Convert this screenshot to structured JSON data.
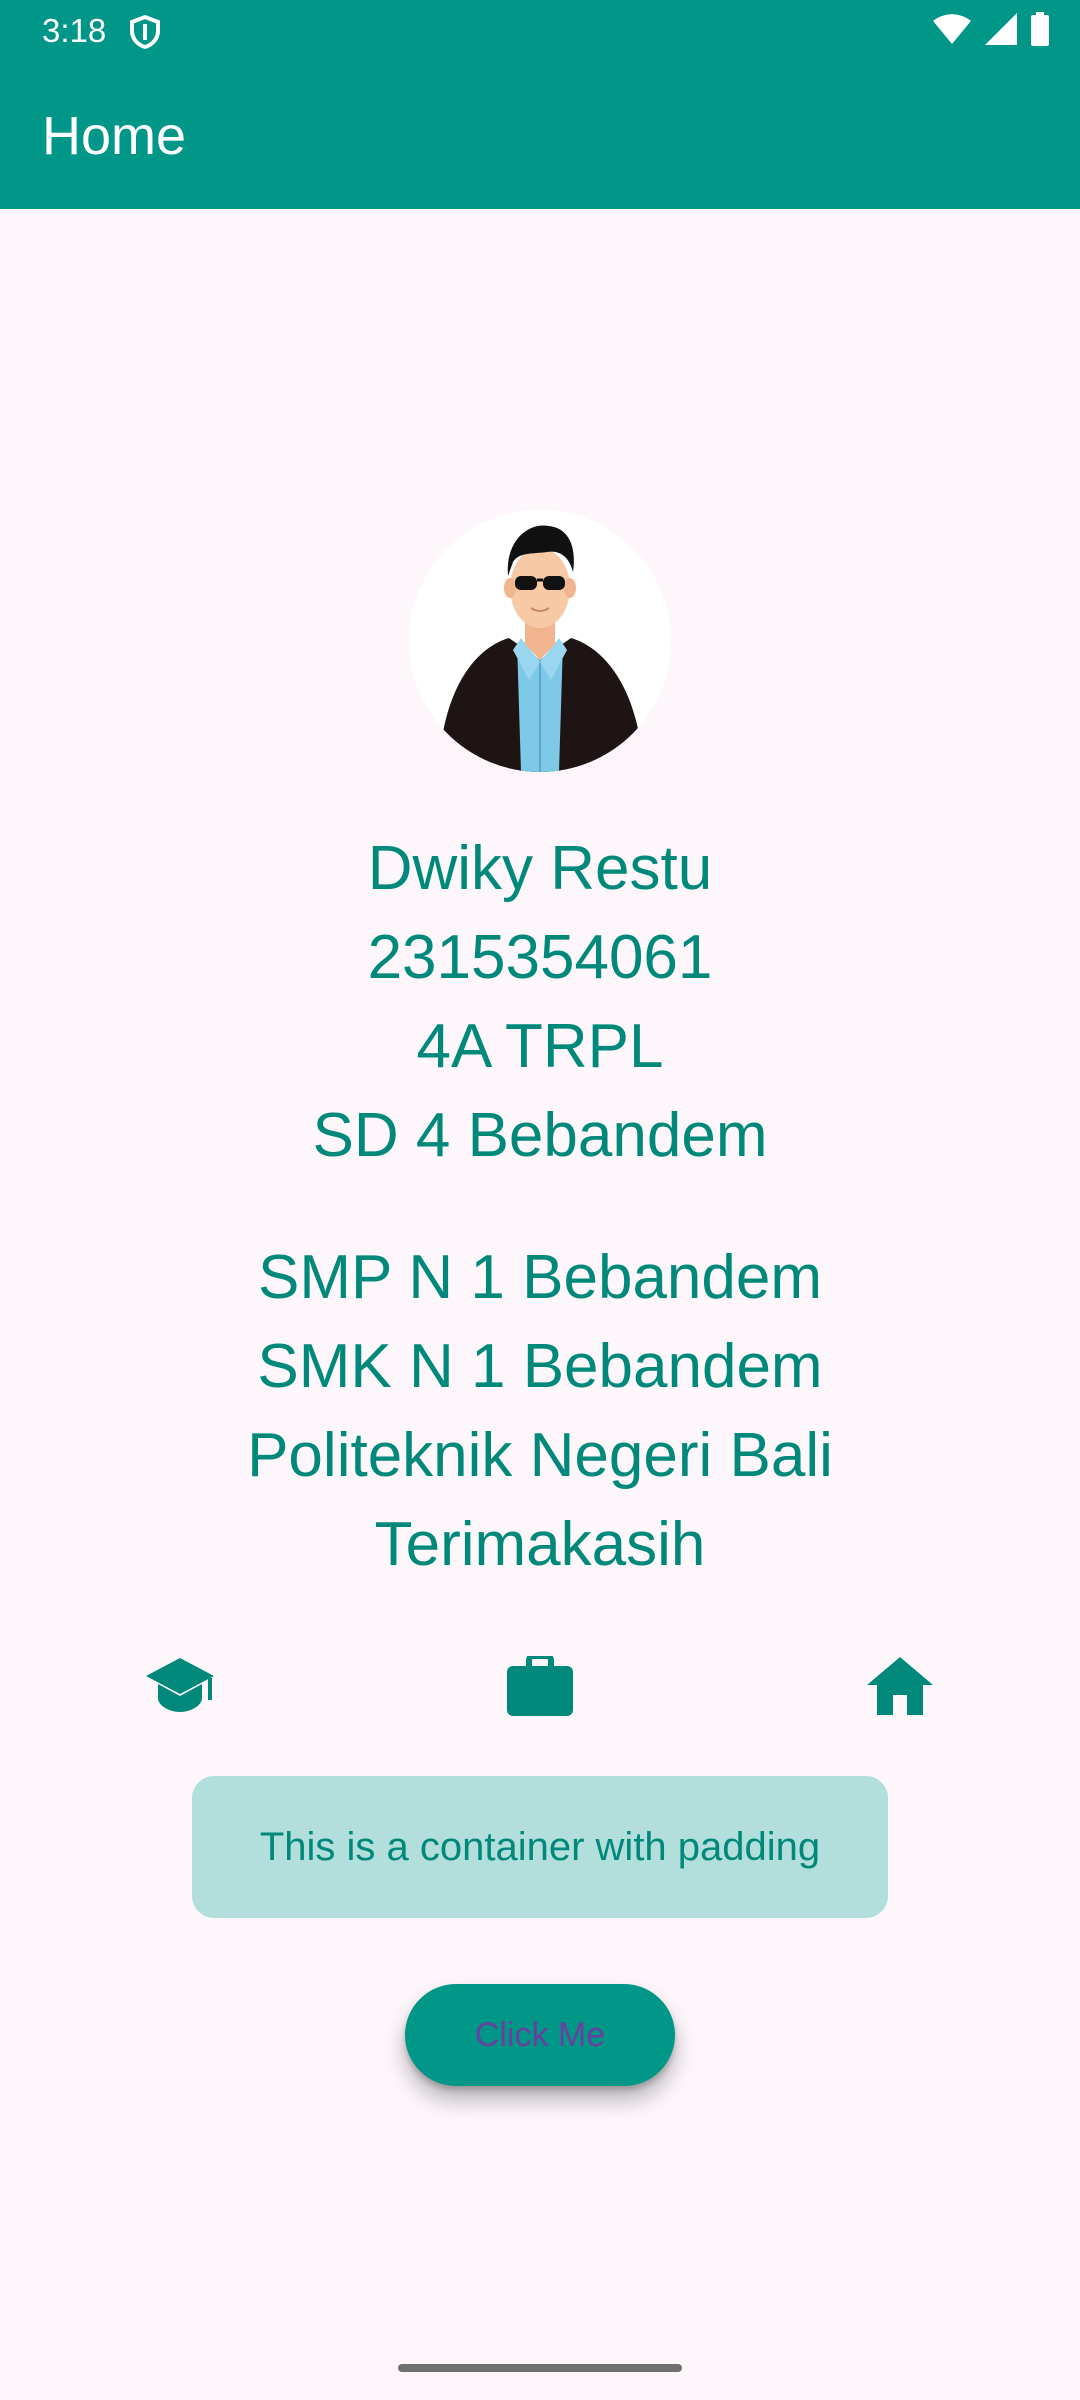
{
  "status_bar": {
    "time": "3:18",
    "icons": [
      "shield-icon",
      "wifi-icon",
      "signal-icon",
      "battery-icon"
    ]
  },
  "app_bar": {
    "title": "Home",
    "color": "#009688"
  },
  "profile": {
    "avatar_icon": "avatar-illustration",
    "lines_group_1": [
      "Dwiky Restu",
      "2315354061",
      "4A TRPL",
      "SD 4 Bebandem"
    ],
    "lines_group_2": [
      "SMP N 1 Bebandem",
      "SMK N 1 Bebandem",
      "Politeknik Negeri Bali",
      "Terimakasih"
    ],
    "text_color": "#00897b"
  },
  "icon_row": [
    "school-icon",
    "work-icon",
    "home-icon"
  ],
  "container": {
    "text": "This is a container with padding",
    "background": "#b2dfdb"
  },
  "button": {
    "label": "Click Me",
    "background": "#009688"
  }
}
